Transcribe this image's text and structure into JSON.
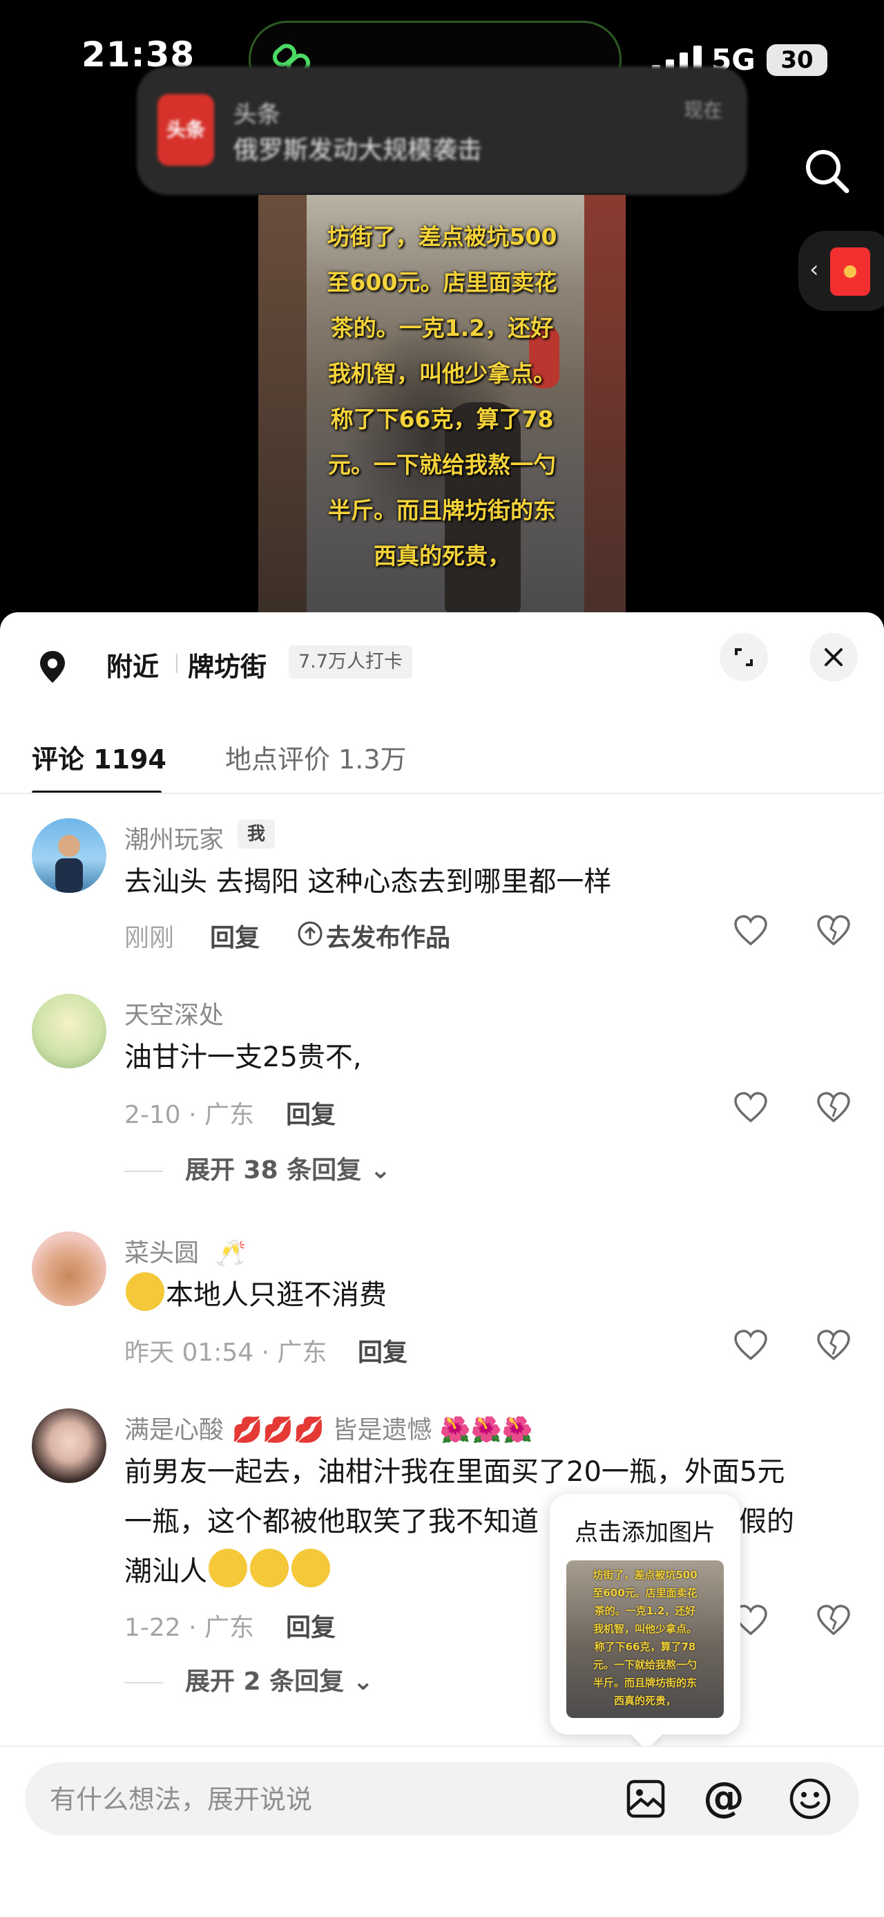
{
  "status_bar": {
    "time": "21:38",
    "network": "5G",
    "battery": "30"
  },
  "notification": {
    "app": "头条",
    "logo_text": "头条",
    "body": "俄罗斯发动大规模袭击",
    "time": "现在"
  },
  "video": {
    "caption_lines": [
      "坊街了，差点被坑500",
      "至600元。店里面卖花",
      "茶的。一克1.2，还好",
      "我机智，叫他少拿点。",
      "称了下66克，算了78",
      "元。一下就给我熬一勺",
      "半斤。而且牌坊街的东",
      "西真的死贵，"
    ]
  },
  "location": {
    "nearby": "附近",
    "place": "牌坊街",
    "checkins": "7.7万人打卡"
  },
  "tabs": [
    {
      "label": "评论 1194",
      "active": true
    },
    {
      "label": "地点评价 1.3万",
      "active": false
    }
  ],
  "comments": [
    {
      "user": "潮州玩家",
      "badge": "我",
      "text": "去汕头 去揭阳 这种心态去到哪里都一样",
      "meta": "刚刚",
      "reply": "回复",
      "post_link": "去发布作品"
    },
    {
      "user": "天空深处",
      "text": "油甘汁一支25贵不,",
      "meta": "2-10 · 广东",
      "reply": "回复",
      "expand": "展开 38 条回复"
    },
    {
      "user": "菜头圆",
      "user_emoji": "🥂",
      "text": "本地人只逛不消费",
      "meta": "昨天 01:54 · 广东",
      "reply": "回复"
    },
    {
      "user": "满是心酸 💋💋💋 皆是遗憾 🌺🌺🌺",
      "text_line1": "前男友一起去，油柑汁我在里面买了20一瓶，外面5元",
      "text_line2": "一瓶，这个都被他取笑了我不知道",
      "text_line2b": "我是假的",
      "text_line3": "潮汕人",
      "meta": "1-22 · 广东",
      "reply": "回复",
      "expand": "展开 2 条回复"
    }
  ],
  "popup": {
    "label": "点击添加图片"
  },
  "input": {
    "placeholder": "有什么想法，展开说说",
    "at_label": "@"
  },
  "colors": {
    "caption": "#f4d23a",
    "sheet_bg": "#ffffff",
    "text": "#161616",
    "muted": "#a5a5a5"
  }
}
